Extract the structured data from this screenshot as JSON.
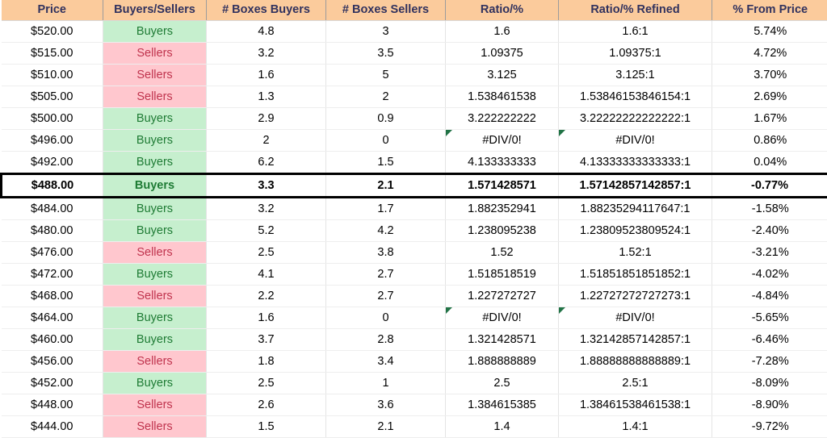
{
  "table": {
    "name": "price-ladder-buyers-sellers-table",
    "columns": [
      {
        "key": "price",
        "label": "Price"
      },
      {
        "key": "bs",
        "label": "Buyers/Sellers"
      },
      {
        "key": "box_buyers",
        "label": "# Boxes Buyers"
      },
      {
        "key": "box_sellers",
        "label": "# Boxes Sellers"
      },
      {
        "key": "ratio",
        "label": "Ratio/%"
      },
      {
        "key": "ratio_ref",
        "label": "Ratio/% Refined"
      },
      {
        "key": "from_price",
        "label": "% From Price"
      }
    ],
    "colors": {
      "header_bg": "#FBCB9C",
      "header_text": "#31325E",
      "buyers_bg": "#C6EFCE",
      "buyers_text": "#1E7B34",
      "sellers_bg": "#FFC7CE",
      "sellers_text": "#C0334D",
      "selected_border": "#000000",
      "error_flag": "#217346",
      "grid_line": "#E4E4E4"
    },
    "rows": [
      {
        "price": "$520.00",
        "bs": "Buyers",
        "box_buyers": "4.8",
        "box_sellers": "3",
        "ratio": "1.6",
        "ratio_ref": "1.6:1",
        "from_price": "5.74%",
        "selected": false,
        "error": false
      },
      {
        "price": "$515.00",
        "bs": "Sellers",
        "box_buyers": "3.2",
        "box_sellers": "3.5",
        "ratio": "1.09375",
        "ratio_ref": "1.09375:1",
        "from_price": "4.72%",
        "selected": false,
        "error": false
      },
      {
        "price": "$510.00",
        "bs": "Sellers",
        "box_buyers": "1.6",
        "box_sellers": "5",
        "ratio": "3.125",
        "ratio_ref": "3.125:1",
        "from_price": "3.70%",
        "selected": false,
        "error": false
      },
      {
        "price": "$505.00",
        "bs": "Sellers",
        "box_buyers": "1.3",
        "box_sellers": "2",
        "ratio": "1.538461538",
        "ratio_ref": "1.53846153846154:1",
        "from_price": "2.69%",
        "selected": false,
        "error": false
      },
      {
        "price": "$500.00",
        "bs": "Buyers",
        "box_buyers": "2.9",
        "box_sellers": "0.9",
        "ratio": "3.222222222",
        "ratio_ref": "3.22222222222222:1",
        "from_price": "1.67%",
        "selected": false,
        "error": false
      },
      {
        "price": "$496.00",
        "bs": "Buyers",
        "box_buyers": "2",
        "box_sellers": "0",
        "ratio": "#DIV/0!",
        "ratio_ref": "#DIV/0!",
        "from_price": "0.86%",
        "selected": false,
        "error": true
      },
      {
        "price": "$492.00",
        "bs": "Buyers",
        "box_buyers": "6.2",
        "box_sellers": "1.5",
        "ratio": "4.133333333",
        "ratio_ref": "4.13333333333333:1",
        "from_price": "0.04%",
        "selected": false,
        "error": false
      },
      {
        "price": "$488.00",
        "bs": "Buyers",
        "box_buyers": "3.3",
        "box_sellers": "2.1",
        "ratio": "1.571428571",
        "ratio_ref": "1.57142857142857:1",
        "from_price": "-0.77%",
        "selected": true,
        "error": false
      },
      {
        "price": "$484.00",
        "bs": "Buyers",
        "box_buyers": "3.2",
        "box_sellers": "1.7",
        "ratio": "1.882352941",
        "ratio_ref": "1.88235294117647:1",
        "from_price": "-1.58%",
        "selected": false,
        "error": false
      },
      {
        "price": "$480.00",
        "bs": "Buyers",
        "box_buyers": "5.2",
        "box_sellers": "4.2",
        "ratio": "1.238095238",
        "ratio_ref": "1.23809523809524:1",
        "from_price": "-2.40%",
        "selected": false,
        "error": false
      },
      {
        "price": "$476.00",
        "bs": "Sellers",
        "box_buyers": "2.5",
        "box_sellers": "3.8",
        "ratio": "1.52",
        "ratio_ref": "1.52:1",
        "from_price": "-3.21%",
        "selected": false,
        "error": false
      },
      {
        "price": "$472.00",
        "bs": "Buyers",
        "box_buyers": "4.1",
        "box_sellers": "2.7",
        "ratio": "1.518518519",
        "ratio_ref": "1.51851851851852:1",
        "from_price": "-4.02%",
        "selected": false,
        "error": false
      },
      {
        "price": "$468.00",
        "bs": "Sellers",
        "box_buyers": "2.2",
        "box_sellers": "2.7",
        "ratio": "1.227272727",
        "ratio_ref": "1.22727272727273:1",
        "from_price": "-4.84%",
        "selected": false,
        "error": false
      },
      {
        "price": "$464.00",
        "bs": "Buyers",
        "box_buyers": "1.6",
        "box_sellers": "0",
        "ratio": "#DIV/0!",
        "ratio_ref": "#DIV/0!",
        "from_price": "-5.65%",
        "selected": false,
        "error": true
      },
      {
        "price": "$460.00",
        "bs": "Buyers",
        "box_buyers": "3.7",
        "box_sellers": "2.8",
        "ratio": "1.321428571",
        "ratio_ref": "1.32142857142857:1",
        "from_price": "-6.46%",
        "selected": false,
        "error": false
      },
      {
        "price": "$456.00",
        "bs": "Sellers",
        "box_buyers": "1.8",
        "box_sellers": "3.4",
        "ratio": "1.888888889",
        "ratio_ref": "1.88888888888889:1",
        "from_price": "-7.28%",
        "selected": false,
        "error": false
      },
      {
        "price": "$452.00",
        "bs": "Buyers",
        "box_buyers": "2.5",
        "box_sellers": "1",
        "ratio": "2.5",
        "ratio_ref": "2.5:1",
        "from_price": "-8.09%",
        "selected": false,
        "error": false
      },
      {
        "price": "$448.00",
        "bs": "Sellers",
        "box_buyers": "2.6",
        "box_sellers": "3.6",
        "ratio": "1.384615385",
        "ratio_ref": "1.38461538461538:1",
        "from_price": "-8.90%",
        "selected": false,
        "error": false
      },
      {
        "price": "$444.00",
        "bs": "Sellers",
        "box_buyers": "1.5",
        "box_sellers": "2.1",
        "ratio": "1.4",
        "ratio_ref": "1.4:1",
        "from_price": "-9.72%",
        "selected": false,
        "error": false
      }
    ]
  }
}
